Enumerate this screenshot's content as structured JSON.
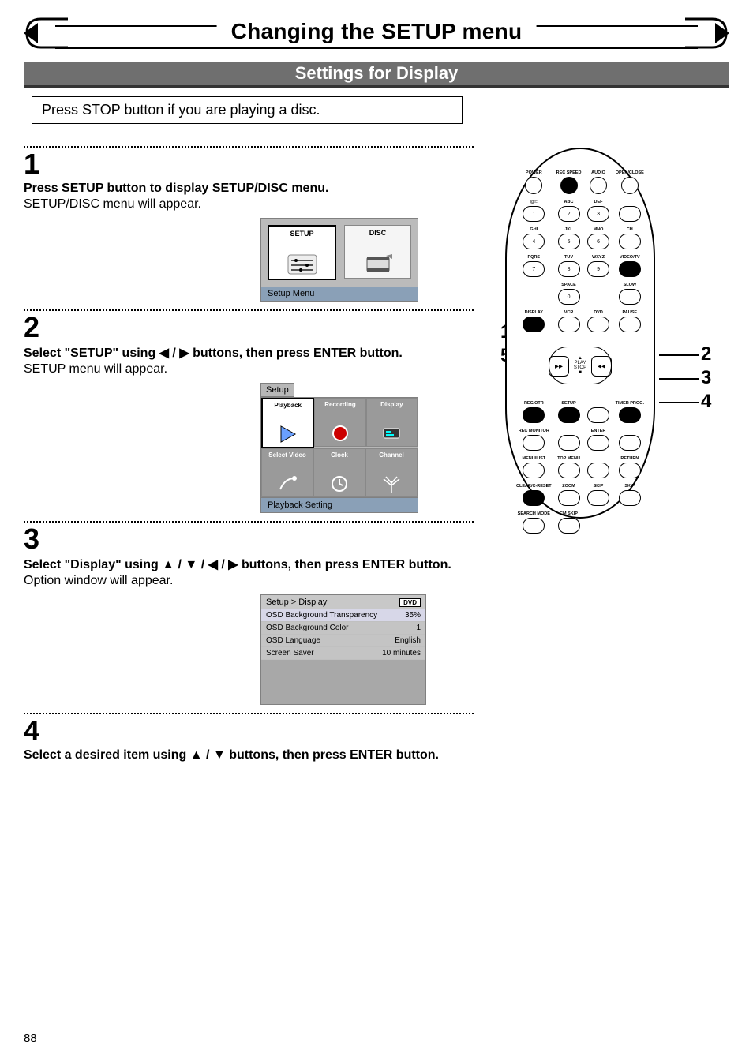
{
  "title": "Changing the SETUP menu",
  "section": "Settings for Display",
  "intro_note": "Press STOP button if you are playing a disc.",
  "steps": [
    {
      "num": "1",
      "head": "Press SETUP button to display SETUP/DISC menu.",
      "body": "SETUP/DISC menu will appear."
    },
    {
      "num": "2",
      "head_pre": "Select \"SETUP\" using ",
      "head_mid": " / ",
      "head_post": " buttons, then press ENTER button.",
      "body": "SETUP menu will appear."
    },
    {
      "num": "3",
      "head_pre": "Select \"Display\" using ",
      "head_mid": " / ",
      "head_post": " buttons, then press ENTER button.",
      "body": "Option window will appear."
    },
    {
      "num": "4",
      "head_pre": "Select a desired item using ",
      "head_mid": " / ",
      "head_post": " buttons, then press ENTER button."
    }
  ],
  "osd1": {
    "tile_setup": "SETUP",
    "tile_disc": "DISC",
    "footer": "Setup Menu"
  },
  "osd2": {
    "tab": "Setup",
    "cells": [
      "Playback",
      "Recording",
      "Display",
      "Select Video",
      "Clock",
      "Channel"
    ],
    "footer": "Playback Setting"
  },
  "osd3": {
    "breadcrumb": "Setup > Display",
    "badge": "DVD",
    "items": [
      {
        "label": "OSD Background Transparency",
        "value": "35%"
      },
      {
        "label": "OSD Background Color",
        "value": "1"
      },
      {
        "label": "OSD Language",
        "value": "English"
      },
      {
        "label": "Screen Saver",
        "value": "10 minutes"
      }
    ]
  },
  "remote": {
    "row1": [
      {
        "lbl": "POWER",
        "cls": "round"
      },
      {
        "lbl": "REC SPEED",
        "cls": "round black"
      },
      {
        "lbl": "AUDIO",
        "cls": "round"
      },
      {
        "lbl": "OPEN/CLOSE",
        "cls": "round"
      }
    ],
    "row2": [
      {
        "lbl": "@!:",
        "txt": "1"
      },
      {
        "lbl": "ABC",
        "txt": "2"
      },
      {
        "lbl": "DEF",
        "txt": "3"
      },
      {
        "lbl": "",
        "txt": ""
      }
    ],
    "row3": [
      {
        "lbl": "GHI",
        "txt": "4"
      },
      {
        "lbl": "JKL",
        "txt": "5"
      },
      {
        "lbl": "MNO",
        "txt": "6"
      },
      {
        "lbl": "CH",
        "txt": ""
      }
    ],
    "row4": [
      {
        "lbl": "PQRS",
        "txt": "7"
      },
      {
        "lbl": "TUV",
        "txt": "8"
      },
      {
        "lbl": "WXYZ",
        "txt": "9"
      },
      {
        "lbl": "VIDEO/TV",
        "cls": "black",
        "txt": ""
      }
    ],
    "row5": [
      {
        "lbl": "",
        "txt": "",
        "hidden": true
      },
      {
        "lbl": "SPACE",
        "txt": "0"
      },
      {
        "lbl": "",
        "txt": "",
        "hidden": true
      },
      {
        "lbl": "SLOW",
        "txt": ""
      }
    ],
    "row6": [
      {
        "lbl": "DISPLAY",
        "cls": "black"
      },
      {
        "lbl": "VCR"
      },
      {
        "lbl": "DVD"
      },
      {
        "lbl": "PAUSE"
      }
    ],
    "nav": {
      "play": "PLAY",
      "stop": "STOP"
    },
    "row7": [
      {
        "lbl": "REC/OTR",
        "cls": "black"
      },
      {
        "lbl": "SETUP",
        "cls": "black"
      },
      {
        "lbl": ""
      },
      {
        "lbl": "TIMER PROG.",
        "cls": "black"
      }
    ],
    "row8": [
      {
        "lbl": "REC MONITOR"
      },
      {
        "lbl": ""
      },
      {
        "lbl": "ENTER"
      },
      {
        "lbl": ""
      }
    ],
    "row9": [
      {
        "lbl": "MENU/LIST"
      },
      {
        "lbl": "TOP MENU"
      },
      {
        "lbl": ""
      },
      {
        "lbl": "RETURN"
      }
    ],
    "row10": [
      {
        "lbl": "CLEAR/C-RESET",
        "cls": "black"
      },
      {
        "lbl": "ZOOM"
      },
      {
        "lbl": "SKIP"
      },
      {
        "lbl": "SKIP"
      }
    ],
    "row11": [
      {
        "lbl": "SEARCH MODE"
      },
      {
        "lbl": "CM SKIP"
      },
      {
        "lbl": "",
        "hidden": true
      },
      {
        "lbl": "",
        "hidden": true
      }
    ]
  },
  "callouts": {
    "left": [
      "1",
      "5"
    ],
    "right": [
      "2",
      "3",
      "4"
    ]
  },
  "page_number": "88"
}
